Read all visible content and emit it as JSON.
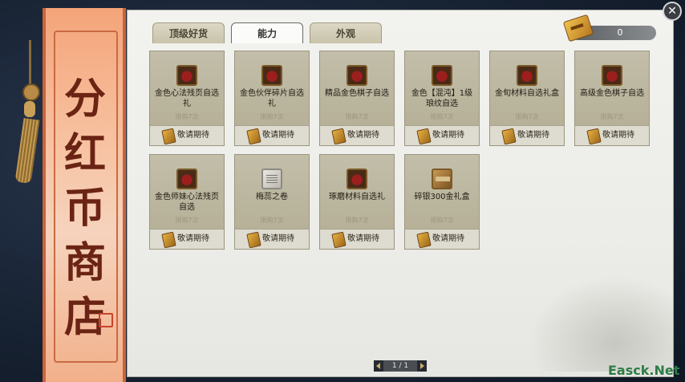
{
  "shop": {
    "title_chars": [
      "分",
      "红",
      "币",
      "商",
      "店"
    ],
    "close_glyph": "✕"
  },
  "tabs": [
    {
      "label": "顶级好货",
      "active": false
    },
    {
      "label": "能力",
      "active": true
    },
    {
      "label": "外观",
      "active": false
    }
  ],
  "currency": {
    "icon": "coin-ticket-icon",
    "value": "0"
  },
  "items": [
    {
      "name": "金色心法残页自选礼",
      "limit": "限购7次",
      "price": "敬请期待",
      "icon": "red-treasure-chest-icon"
    },
    {
      "name": "金色伙伴碎片自选礼",
      "limit": "限购7次",
      "price": "敬请期待",
      "icon": "red-treasure-chest-icon"
    },
    {
      "name": "精品金色棋子自选",
      "limit": "限购7次",
      "price": "敬请期待",
      "icon": "red-treasure-chest-icon"
    },
    {
      "name": "金色【混沌】1级琅纹自选",
      "limit": "限购7次",
      "price": "敬请期待",
      "icon": "red-treasure-chest-icon"
    },
    {
      "name": "金旬材料自选礼盒",
      "limit": "限购7次",
      "price": "敬请期待",
      "icon": "red-treasure-chest-icon"
    },
    {
      "name": "高级金色棋子自选",
      "limit": "限购7次",
      "price": "敬请期待",
      "icon": "red-treasure-chest-icon"
    },
    {
      "name": "金色师妹心法残页自选",
      "limit": "限购7次",
      "price": "敬请期待",
      "icon": "red-treasure-chest-icon"
    },
    {
      "name": "梅蕊之卷",
      "limit": "限购7次",
      "price": "敬请期待",
      "icon": "scroll-icon"
    },
    {
      "name": "琢磨材料自选礼",
      "limit": "限购7次",
      "price": "敬请期待",
      "icon": "red-treasure-chest-icon"
    },
    {
      "name": "碎银300金礼盒",
      "limit": "限购7次",
      "price": "敬请期待",
      "icon": "silver-box-icon"
    }
  ],
  "pager": {
    "text": "1 / 1"
  },
  "watermark": "Easck.Net",
  "colors": {
    "banner": "#f4a479",
    "card": "#c2bea9",
    "panel": "#f2f2ef",
    "accent_gold": "#e6b042"
  }
}
